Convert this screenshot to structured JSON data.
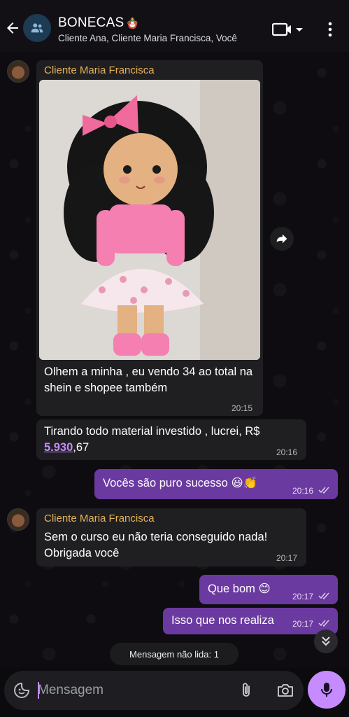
{
  "header": {
    "title": "BONECAS",
    "title_emoji": "🪆",
    "subtitle": "Cliente Ana, Cliente Maria Francisca, Você",
    "icons": [
      "back-arrow-icon",
      "group-icon",
      "video-call-icon",
      "chevron-down-icon",
      "more-vert-icon"
    ]
  },
  "messages": [
    {
      "sender": "Cliente Maria Francisca",
      "has_image": true,
      "text": "Olhem a minha , eu vendo 34 ao total na shein e shopee também",
      "time": "20:15",
      "direction": "in"
    },
    {
      "text_before": "Tirando todo material investido , lucrei, R$",
      "money": "5.930",
      "text_after": ",67",
      "time": "20:16",
      "direction": "in"
    },
    {
      "text": "Vocês são puro sucesso 😃👏",
      "time": "20:16",
      "direction": "out"
    },
    {
      "sender": "Cliente Maria Francisca",
      "text": "Sem o curso eu não teria conseguido nada! Obrigada você",
      "time": "20:17",
      "direction": "in"
    },
    {
      "text": "Que bom 😊",
      "time": "20:17",
      "direction": "out"
    },
    {
      "text": "Isso que nos realiza",
      "time": "20:17",
      "direction": "out"
    }
  ],
  "unread_label": "Mensagem não lida: 1",
  "composer": {
    "placeholder": "Mensagem"
  },
  "colors": {
    "incoming_bubble": "#1f1f22",
    "outgoing_bubble": "#6b3aa0",
    "sender_name": "#e6b25a",
    "accent": "#c58bff"
  }
}
